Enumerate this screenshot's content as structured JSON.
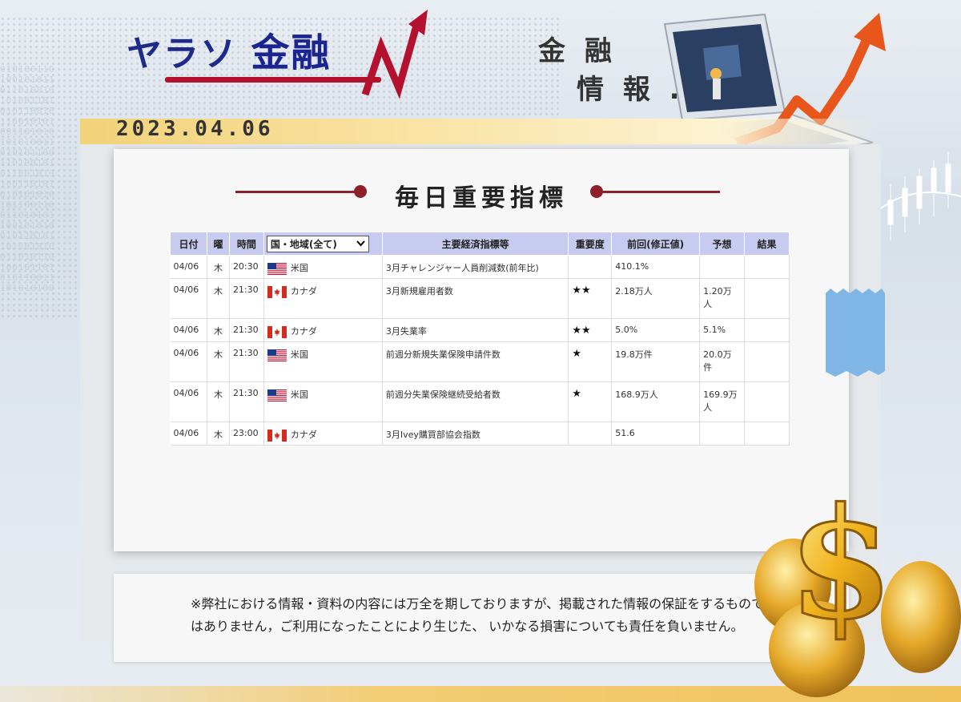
{
  "header": {
    "brand": "ヤラソ",
    "brand_kanji": "金融",
    "subtitle_line1": "金 融",
    "subtitle_line2": "情 報 .."
  },
  "date": "2023.04.06",
  "section": {
    "title": "毎日重要指標"
  },
  "table": {
    "headers": {
      "date": "日付",
      "day": "曜",
      "time": "時間",
      "country_select": "国・地域(全て)",
      "indicator": "主要経済指標等",
      "importance": "重要度",
      "previous": "前回(修正値)",
      "forecast": "予想",
      "result": "結果"
    },
    "rows": [
      {
        "date": "04/06",
        "day": "木",
        "time": "20:30",
        "flag": "us",
        "country": "米国",
        "indicator": "3月チャレンジャー人員削減数(前年比)",
        "importance": "",
        "previous": "410.1%",
        "forecast": "",
        "result": ""
      },
      {
        "date": "04/06",
        "day": "木",
        "time": "21:30",
        "flag": "ca",
        "country": "カナダ",
        "indicator": "3月新規雇用者数",
        "importance": "★★",
        "previous": "2.18万人",
        "forecast": "1.20万\n人",
        "result": ""
      },
      {
        "date": "04/06",
        "day": "木",
        "time": "21:30",
        "flag": "ca",
        "country": "カナダ",
        "indicator": "3月失業率",
        "importance": "★★",
        "previous": "5.0%",
        "forecast": "5.1%",
        "result": ""
      },
      {
        "date": "04/06",
        "day": "木",
        "time": "21:30",
        "flag": "us",
        "country": "米国",
        "indicator": "前週分新規失業保険申請件数",
        "importance": "★",
        "previous": "19.8万件",
        "forecast": "20.0万\n件",
        "result": ""
      },
      {
        "date": "04/06",
        "day": "木",
        "time": "21:30",
        "flag": "us",
        "country": "米国",
        "indicator": "前週分失業保険継続受給者数",
        "importance": "★",
        "previous": "168.9万人",
        "forecast": "169.9万\n人",
        "result": ""
      },
      {
        "date": "04/06",
        "day": "木",
        "time": "23:00",
        "flag": "ca",
        "country": "カナダ",
        "indicator": "3月Ivey購買部協会指数",
        "importance": "",
        "previous": "51.6",
        "forecast": "",
        "result": ""
      }
    ]
  },
  "disclaimer": "※弊社における情報・資料の内容には万全を期しておりますが、掲載された情報の保証をするものではありません，ご利用になったことにより生じた、 いかなる損害についても責任を負いません。",
  "colors": {
    "brand_blue": "#1e2a8a",
    "brand_red": "#b3112d",
    "header_row": "#c7cbef",
    "accent_line": "#8e1f2b",
    "gold": "#f3cd75"
  }
}
